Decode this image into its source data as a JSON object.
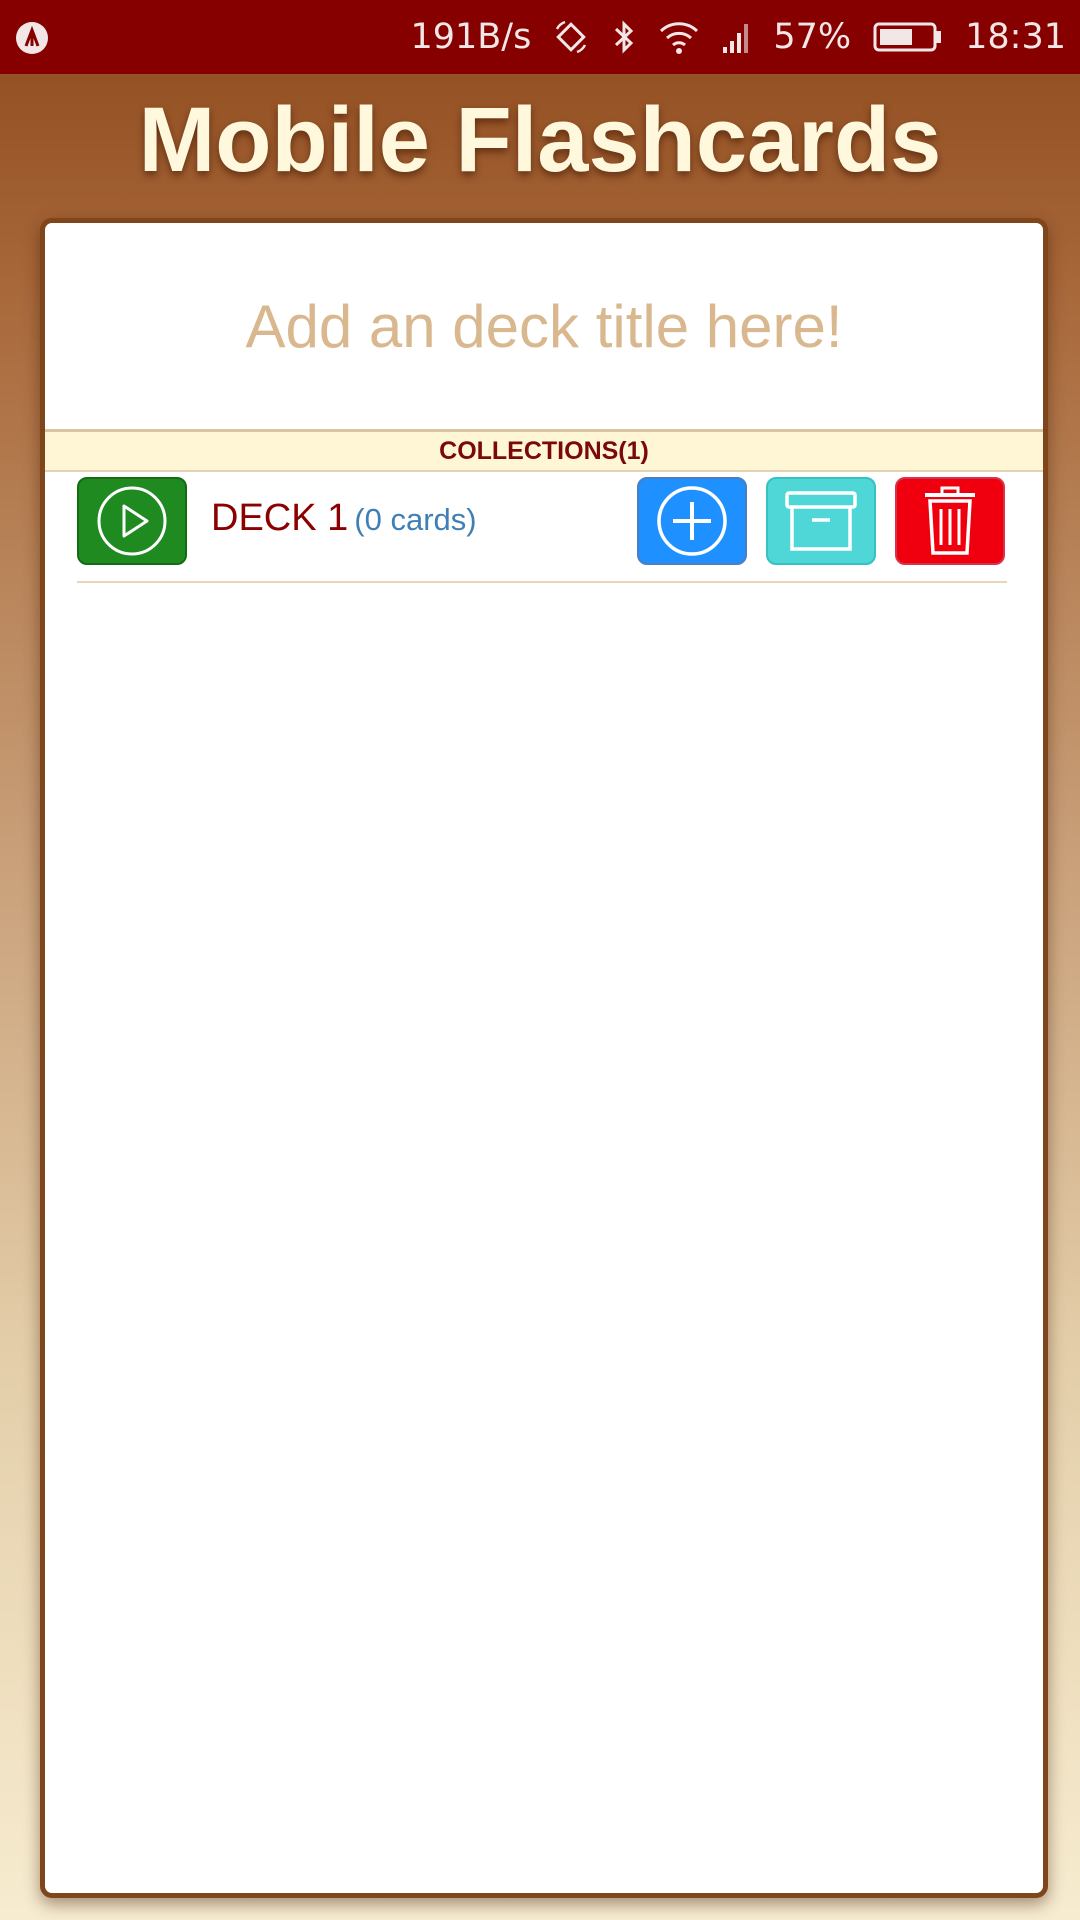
{
  "status_bar": {
    "network_speed": "191B/s",
    "battery": "57%",
    "time": "18:31",
    "icons": [
      "app-notification-icon",
      "rotate-icon",
      "bluetooth-icon",
      "wifi-icon",
      "signal-icon",
      "battery-icon"
    ]
  },
  "app": {
    "title": "Mobile Flashcards"
  },
  "deck_input": {
    "placeholder": "Add an deck title here!"
  },
  "collections": {
    "label": "COLLECTIONS(1)"
  },
  "decks": [
    {
      "name": "DECK 1",
      "count_label": "(0 cards)",
      "actions": [
        "play-icon",
        "plus-circle-icon",
        "archive-icon",
        "trash-icon"
      ]
    }
  ],
  "colors": {
    "status_bar": "#870000",
    "title_text": "#fff8dc",
    "play_button": "#1f8a20",
    "add_button": "#1e90ff",
    "archive_button": "#4fd6d6",
    "delete_button": "#f0000f",
    "deck_name": "#8b0000",
    "deck_count": "#3f7fb6",
    "placeholder": "#d9b88f"
  }
}
